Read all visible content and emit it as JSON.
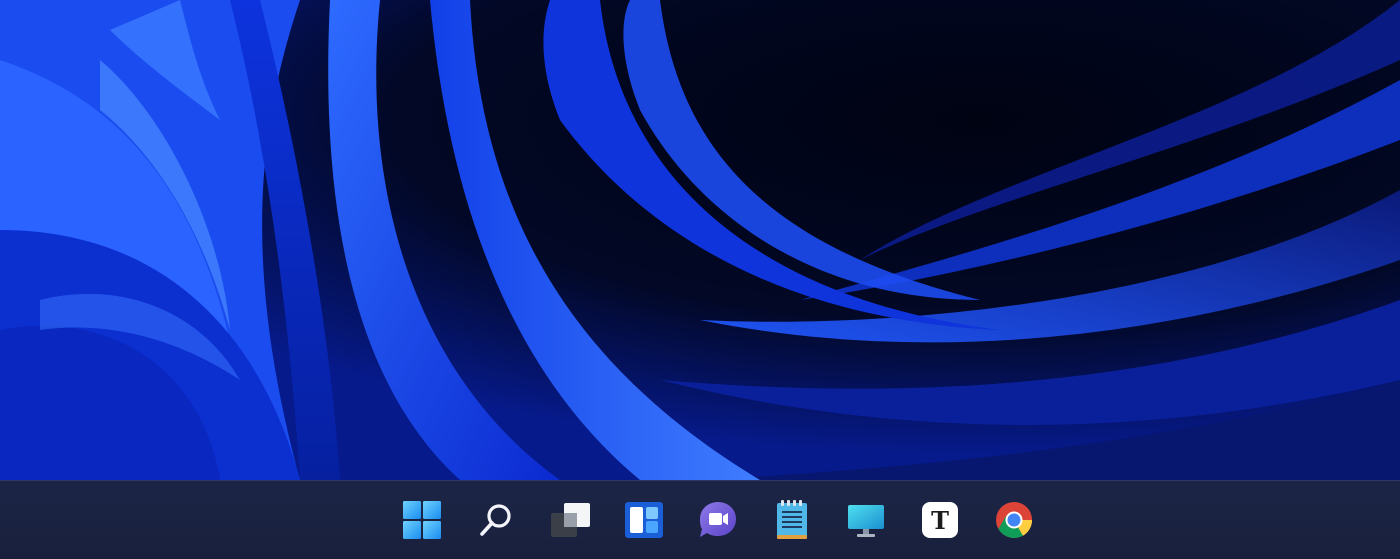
{
  "desktop": {
    "wallpaper": "windows-11-bloom",
    "colors": {
      "deep": "#02061f",
      "mid": "#0a2bd6",
      "bright": "#2f6bff",
      "highlight": "#4a8cff"
    }
  },
  "taskbar": {
    "background": "#1b2342",
    "items": [
      {
        "name": "start-button",
        "icon": "windows-logo-icon"
      },
      {
        "name": "search-button",
        "icon": "search-icon"
      },
      {
        "name": "task-view-button",
        "icon": "task-view-icon"
      },
      {
        "name": "widgets-button",
        "icon": "widgets-icon"
      },
      {
        "name": "teams-chat-button",
        "icon": "video-chat-icon"
      },
      {
        "name": "notepad-button",
        "icon": "notepad-icon"
      },
      {
        "name": "remote-desktop-button",
        "icon": "monitor-icon"
      },
      {
        "name": "typora-button",
        "icon": "text-editor-icon",
        "glyph": "T"
      },
      {
        "name": "chrome-button",
        "icon": "chrome-icon"
      }
    ]
  }
}
